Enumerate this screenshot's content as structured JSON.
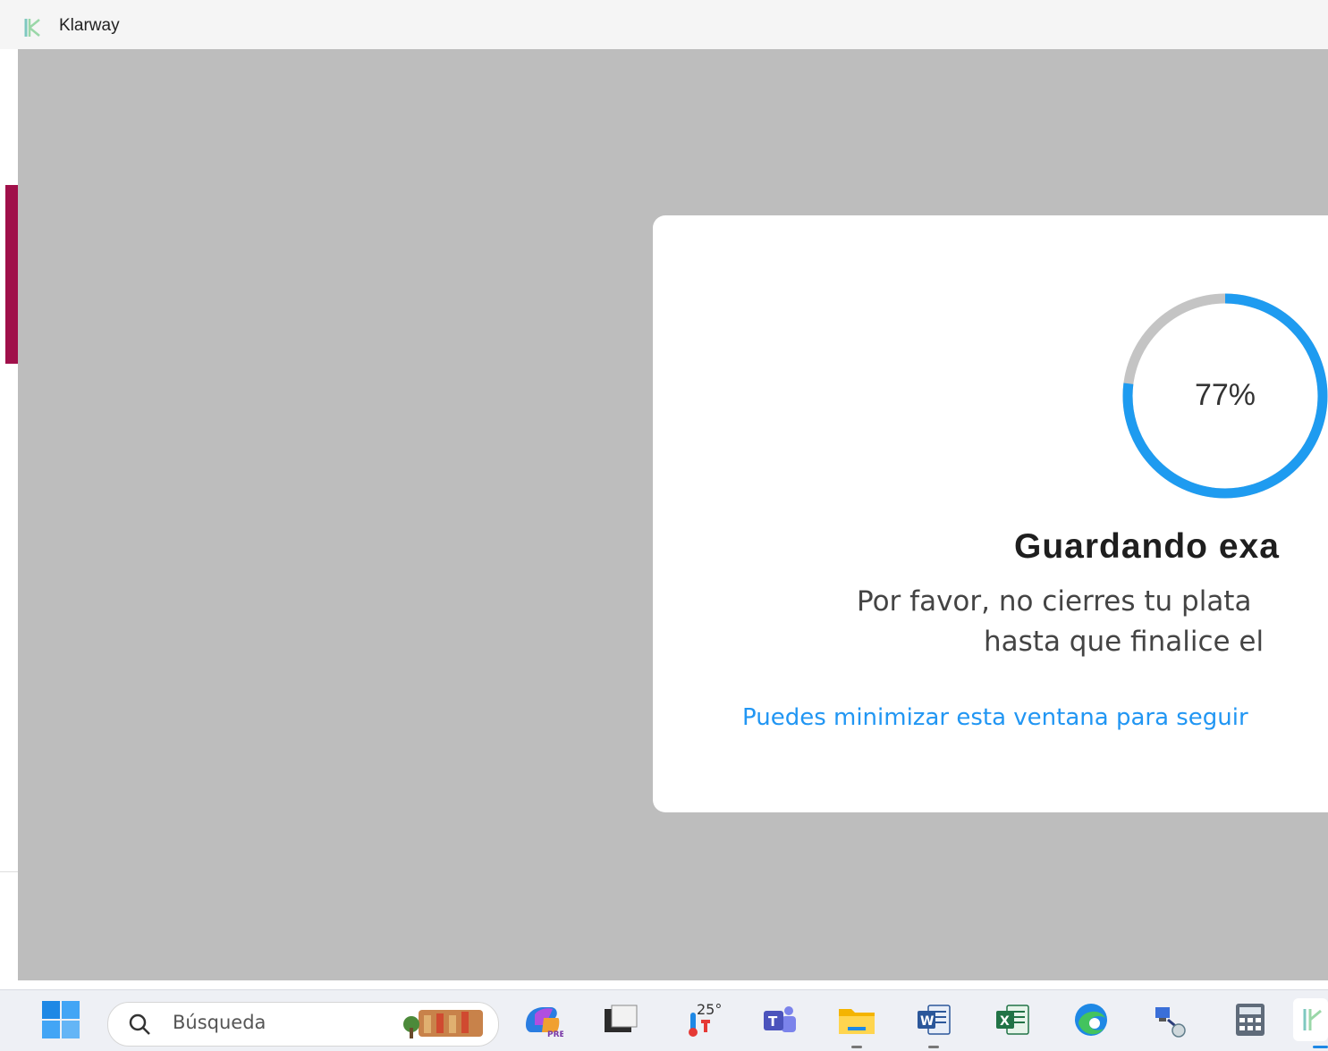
{
  "window": {
    "title": "Klarway"
  },
  "modal": {
    "progress_percent": 77,
    "progress_label": "77%",
    "heading": "Guardando exa",
    "message_line1": "Por favor, no cierres tu plata",
    "message_line2": "hasta que finalice el",
    "link_text": "Puedes minimizar esta ventana para seguir"
  },
  "taskbar": {
    "search_placeholder": "Búsqueda",
    "weather_temp": "25°",
    "icons": [
      "windows-start-icon",
      "copilot-icon",
      "task-view-icon",
      "weather-icon",
      "teams-icon",
      "file-explorer-icon",
      "word-icon",
      "excel-icon",
      "edge-icon",
      "network-app-icon",
      "calculator-icon",
      "klarway-icon"
    ]
  },
  "colors": {
    "progress": "#1e9bf0",
    "progress_track": "#c4c4c4",
    "accent_left": "#a0104a",
    "link": "#2196f3",
    "overlay": "#bdbdbd"
  }
}
